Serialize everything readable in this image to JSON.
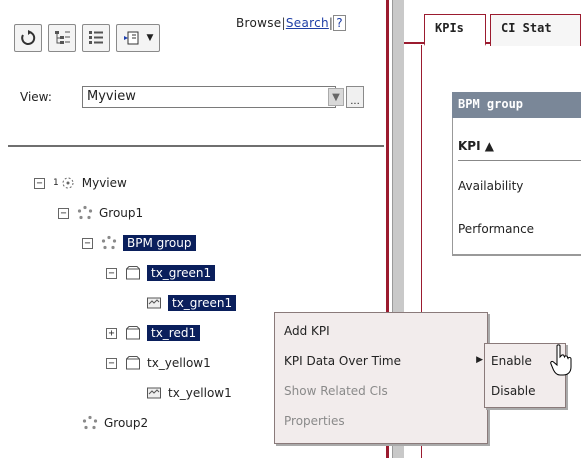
{
  "toolbar": {
    "browse_label": "Browse",
    "search_label": "Search",
    "help_label": "?",
    "sep": "|"
  },
  "view": {
    "label": "View:",
    "value": "Myview",
    "more": "..."
  },
  "tree": {
    "root_prefix": "1",
    "root": "Myview",
    "group1": "Group1",
    "bpm": "BPM group",
    "tx_green_parent": "tx_green1",
    "tx_green_child": "tx_green1",
    "tx_red": "tx_red1",
    "tx_yellow_parent": "tx_yellow1",
    "tx_yellow_child": "tx_yellow1",
    "group2": "Group2",
    "collapse": "−",
    "expand": "+"
  },
  "tabs": {
    "kpis": "KPIs",
    "ci_status": "CI Stat"
  },
  "panel": {
    "header": "BPM group",
    "kpi_col": "KPI ▲",
    "row1": "Availability",
    "row2": "Performance"
  },
  "context_menu": {
    "add_kpi": "Add KPI",
    "kpi_data_over_time": "KPI Data Over Time",
    "show_related": "Show Related CIs",
    "properties": "Properties"
  },
  "submenu": {
    "enable": "Enable",
    "disable": "Disable"
  },
  "colors": {
    "selection": "#0a1f5c",
    "accent": "#9b1b2f",
    "header": "#7a8798"
  }
}
